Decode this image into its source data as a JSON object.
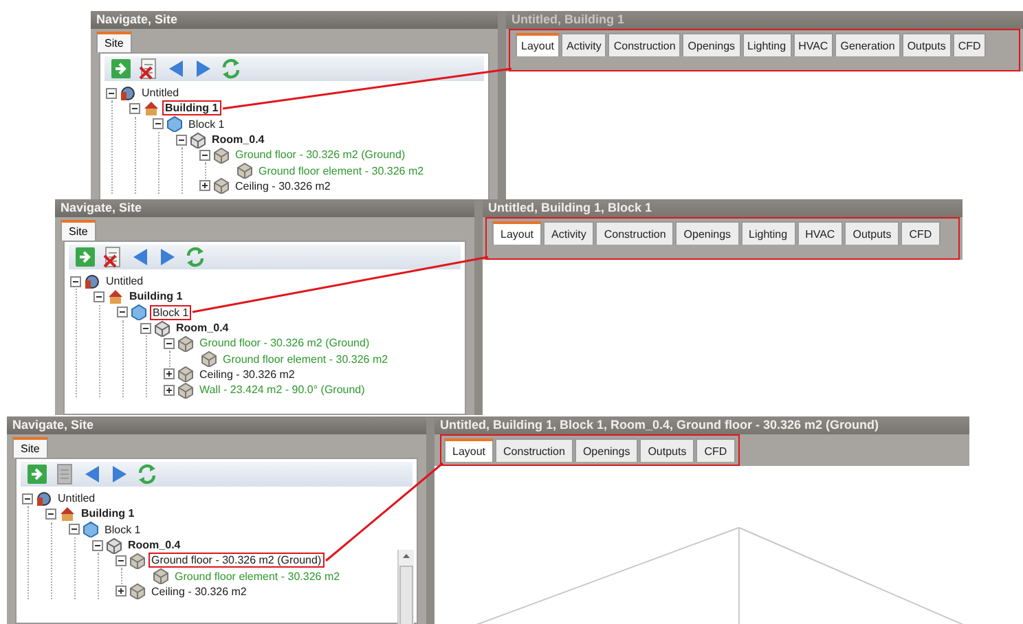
{
  "panels": [
    {
      "navigator": {
        "title": "Navigate, Site",
        "tabs": [
          {
            "label": "Site",
            "selected": true
          }
        ],
        "toolbar": [
          {
            "kind": "go",
            "disabled": false
          },
          {
            "kind": "delete",
            "disabled": false
          },
          {
            "kind": "back",
            "disabled": false
          },
          {
            "kind": "forward",
            "disabled": false
          },
          {
            "kind": "refresh",
            "disabled": false
          }
        ],
        "tree": [
          {
            "label": "Untitled",
            "kind": "site",
            "color": "#202020",
            "expanded": true,
            "boxed": false,
            "children": [
              {
                "label": "Building 1",
                "kind": "building",
                "color": "#202020",
                "expanded": true,
                "boxed": true,
                "children": [
                  {
                    "label": "Block 1",
                    "kind": "block",
                    "color": "#202020",
                    "expanded": true,
                    "boxed": false,
                    "children": [
                      {
                        "label": "Room_0.4",
                        "kind": "zone",
                        "color": "#202020",
                        "expanded": true,
                        "boxed": false,
                        "children": [
                          {
                            "label": "Ground floor - 30.326 m2 (Ground)",
                            "kind": "surface",
                            "color": "#2f9a2f",
                            "expanded": true,
                            "boxed": false,
                            "children": [
                              {
                                "label": "Ground floor element - 30.326 m2",
                                "kind": "surface",
                                "color": "#2f9a2f",
                                "boxed": false
                              }
                            ]
                          },
                          {
                            "label": "Ceiling - 30.326 m2",
                            "kind": "surface",
                            "color": "#202020",
                            "expanded": false,
                            "boxed": false
                          }
                        ]
                      }
                    ]
                  }
                ]
              }
            ]
          }
        ]
      },
      "editor": {
        "title": "Untitled, Building 1",
        "tabs_boxed": true,
        "tabs": [
          {
            "label": "Layout",
            "selected": true
          },
          {
            "label": "Activity",
            "selected": false
          },
          {
            "label": "Construction",
            "selected": false
          },
          {
            "label": "Openings",
            "selected": false
          },
          {
            "label": "Lighting",
            "selected": false
          },
          {
            "label": "HVAC",
            "selected": false
          },
          {
            "label": "Generation",
            "selected": false
          },
          {
            "label": "Outputs",
            "selected": false
          },
          {
            "label": "CFD",
            "selected": false
          }
        ]
      }
    },
    {
      "navigator": {
        "title": "Navigate, Site",
        "tabs": [
          {
            "label": "Site",
            "selected": true
          }
        ],
        "toolbar": [
          {
            "kind": "go",
            "disabled": false
          },
          {
            "kind": "delete",
            "disabled": false
          },
          {
            "kind": "back",
            "disabled": false
          },
          {
            "kind": "forward",
            "disabled": false
          },
          {
            "kind": "refresh",
            "disabled": false
          }
        ],
        "tree": [
          {
            "label": "Untitled",
            "kind": "site",
            "color": "#202020",
            "expanded": true,
            "boxed": false,
            "children": [
              {
                "label": "Building 1",
                "kind": "building",
                "color": "#202020",
                "expanded": true,
                "boxed": false,
                "children": [
                  {
                    "label": "Block 1",
                    "kind": "block",
                    "color": "#202020",
                    "expanded": true,
                    "boxed": true,
                    "children": [
                      {
                        "label": "Room_0.4",
                        "kind": "zone",
                        "color": "#202020",
                        "expanded": true,
                        "boxed": false,
                        "children": [
                          {
                            "label": "Ground floor - 30.326 m2 (Ground)",
                            "kind": "surface",
                            "color": "#2f9a2f",
                            "expanded": true,
                            "boxed": false,
                            "children": [
                              {
                                "label": "Ground floor element - 30.326 m2",
                                "kind": "surface",
                                "color": "#2f9a2f",
                                "boxed": false
                              }
                            ]
                          },
                          {
                            "label": "Ceiling - 30.326 m2",
                            "kind": "surface",
                            "color": "#202020",
                            "expanded": false,
                            "boxed": false
                          },
                          {
                            "label": "Wall - 23.424 m2 - 90.0° (Ground)",
                            "kind": "surface",
                            "color": "#2f9a2f",
                            "expanded": false,
                            "boxed": false
                          }
                        ]
                      }
                    ]
                  }
                ]
              }
            ]
          }
        ]
      },
      "editor": {
        "title": "Untitled, Building 1, Block 1",
        "tabs_boxed": true,
        "tabs": [
          {
            "label": "Layout",
            "selected": true
          },
          {
            "label": "Activity",
            "selected": false
          },
          {
            "label": "Construction",
            "selected": false
          },
          {
            "label": "Openings",
            "selected": false
          },
          {
            "label": "Lighting",
            "selected": false
          },
          {
            "label": "HVAC",
            "selected": false
          },
          {
            "label": "Outputs",
            "selected": false
          },
          {
            "label": "CFD",
            "selected": false
          }
        ]
      }
    },
    {
      "navigator": {
        "title": "Navigate, Site",
        "tabs": [
          {
            "label": "Site",
            "selected": true
          }
        ],
        "toolbar": [
          {
            "kind": "go",
            "disabled": false
          },
          {
            "kind": "delete",
            "disabled": true
          },
          {
            "kind": "back",
            "disabled": false
          },
          {
            "kind": "forward",
            "disabled": false
          },
          {
            "kind": "refresh",
            "disabled": false
          }
        ],
        "tree": [
          {
            "label": "Untitled",
            "kind": "site",
            "color": "#202020",
            "expanded": true,
            "boxed": false,
            "children": [
              {
                "label": "Building 1",
                "kind": "building",
                "color": "#202020",
                "expanded": true,
                "boxed": false,
                "children": [
                  {
                    "label": "Block 1",
                    "kind": "block",
                    "color": "#202020",
                    "expanded": true,
                    "boxed": false,
                    "children": [
                      {
                        "label": "Room_0.4",
                        "kind": "zone",
                        "color": "#202020",
                        "expanded": true,
                        "boxed": false,
                        "children": [
                          {
                            "label": "Ground floor - 30.326 m2 (Ground)",
                            "kind": "surface",
                            "color": "#202020",
                            "expanded": true,
                            "boxed": true,
                            "children": [
                              {
                                "label": "Ground floor element - 30.326 m2",
                                "kind": "surface",
                                "color": "#2f9a2f",
                                "boxed": false
                              }
                            ]
                          },
                          {
                            "label": "Ceiling - 30.326 m2",
                            "kind": "surface",
                            "color": "#202020",
                            "expanded": false,
                            "boxed": false
                          }
                        ]
                      }
                    ]
                  }
                ]
              }
            ]
          }
        ]
      },
      "editor": {
        "title": "Untitled, Building 1, Block 1, Room_0.4, Ground floor - 30.326 m2 (Ground)",
        "tabs_boxed": true,
        "tabs": [
          {
            "label": "Layout",
            "selected": true
          },
          {
            "label": "Construction",
            "selected": false
          },
          {
            "label": "Openings",
            "selected": false
          },
          {
            "label": "Outputs",
            "selected": false
          },
          {
            "label": "CFD",
            "selected": false
          }
        ]
      }
    }
  ]
}
